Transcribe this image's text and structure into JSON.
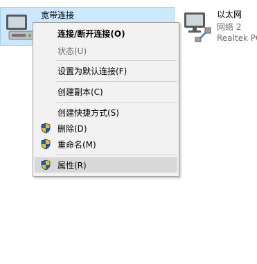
{
  "adapters": {
    "broadband": {
      "name": "宽带连接",
      "icon": "network-adapter-icon"
    },
    "ethernet": {
      "name": "以太网",
      "network": "网络 2",
      "device": "Realtek PC",
      "icon": "network-adapter-cable-icon"
    }
  },
  "context_menu": {
    "items": [
      {
        "label": "连接/断开连接(O)",
        "style": "bold"
      },
      {
        "label": "状态(U)",
        "state": "disabled"
      },
      {
        "label": "设置为默认连接(F)"
      },
      {
        "label": "创建副本(C)"
      },
      {
        "label": "创建快捷方式(S)"
      },
      {
        "label": "删除(D)",
        "icon": "uac-shield-icon"
      },
      {
        "label": "重命名(M)",
        "icon": "uac-shield-icon"
      },
      {
        "label": "属性(R)",
        "icon": "uac-shield-icon",
        "state": "highlighted"
      }
    ]
  },
  "colors": {
    "selection_bg": "#cce8ff",
    "selection_border": "#99d1ff",
    "menu_bg": "#f2f2f2",
    "menu_highlight": "#d8d8d8",
    "disabled_text": "#6d6d6d"
  }
}
